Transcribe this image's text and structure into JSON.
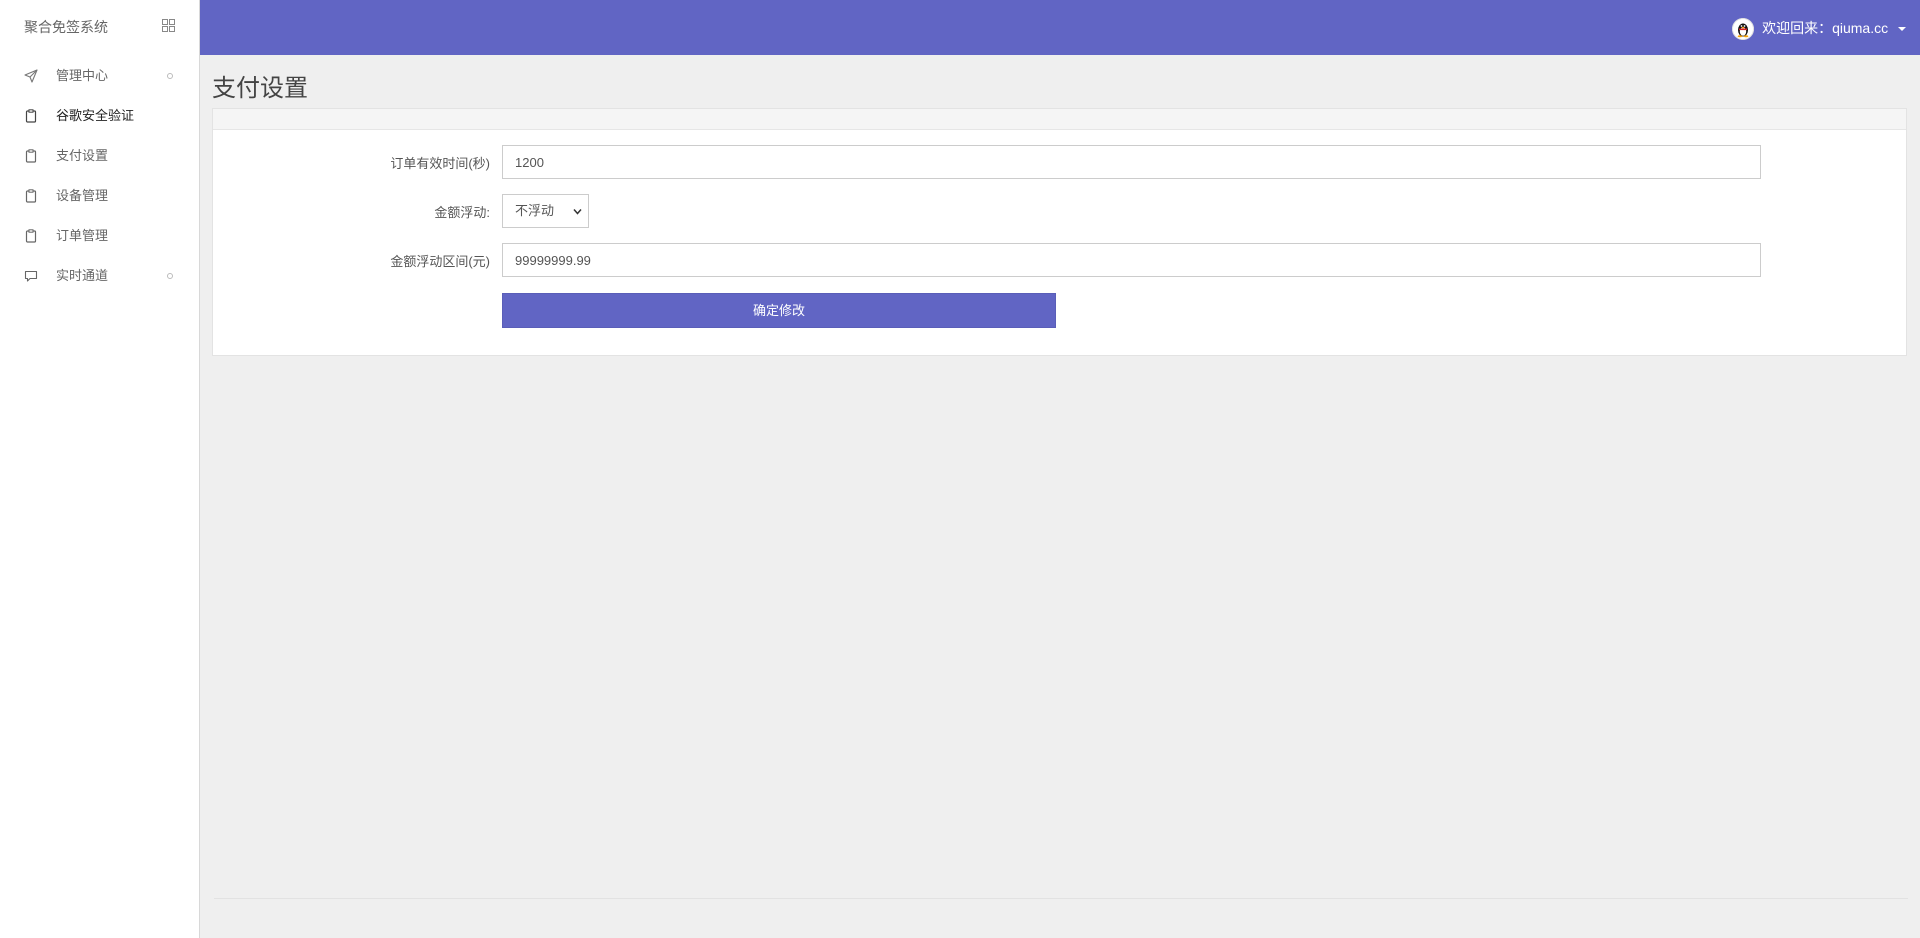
{
  "sidebar": {
    "brand": "聚合免签系统",
    "items": [
      {
        "label": "管理中心",
        "icon": "send-icon",
        "badge": true,
        "active": false
      },
      {
        "label": "谷歌安全验证",
        "icon": "clipboard-icon",
        "badge": false,
        "active": true
      },
      {
        "label": "支付设置",
        "icon": "clipboard-icon",
        "badge": false,
        "active": false
      },
      {
        "label": "设备管理",
        "icon": "clipboard-icon",
        "badge": false,
        "active": false
      },
      {
        "label": "订单管理",
        "icon": "clipboard-icon",
        "badge": false,
        "active": false
      },
      {
        "label": "实时通道",
        "icon": "message-icon",
        "badge": true,
        "active": false
      }
    ]
  },
  "header": {
    "welcome": "欢迎回来：qiuma.cc",
    "accent": "#6165c4"
  },
  "page": {
    "title": "支付设置"
  },
  "form": {
    "order_timeout_label": "订单有效时间(秒)",
    "order_timeout_value": "1200",
    "float_label": "金额浮动:",
    "float_selected": "不浮动",
    "float_range_label": "金额浮动区间(元)",
    "float_range_value": "99999999.99",
    "submit_label": "确定修改"
  }
}
